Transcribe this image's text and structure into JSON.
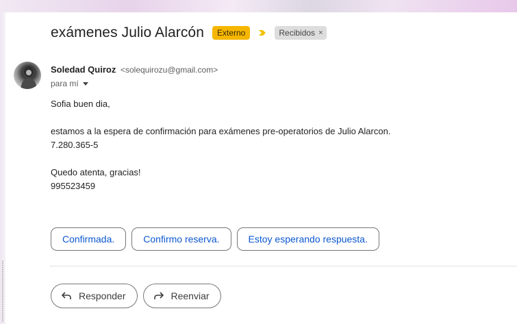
{
  "email": {
    "subject": "exámenes Julio Alarcón",
    "labels": {
      "external": "Externo",
      "inbox": "Recibidos",
      "inbox_close": "×"
    },
    "sender": {
      "name": "Soledad Quiroz",
      "email": "<solequirozu@gmail.com>"
    },
    "to_line": "para mí",
    "body_lines": [
      "Sofia buen dia,",
      "",
      "estamos a la espera de confirmación para exámenes pre-operatorios de Julio Alarcon.",
      "7.280.365-5",
      "",
      "Quedo atenta, gracias!",
      "995523459"
    ]
  },
  "smart_replies": [
    "Confirmada.",
    "Confirmo reserva.",
    "Estoy esperando respuesta."
  ],
  "actions": {
    "reply": "Responder",
    "forward": "Reenviar"
  },
  "colors": {
    "external_label": "#f6b600",
    "importance_marker": "#f2c200",
    "link_blue": "#0b57d0"
  },
  "icons": {
    "importance": "importance-marker-icon",
    "reply": "reply-arrow-icon",
    "forward": "forward-arrow-icon",
    "to_dropdown": "chevron-down-icon"
  }
}
